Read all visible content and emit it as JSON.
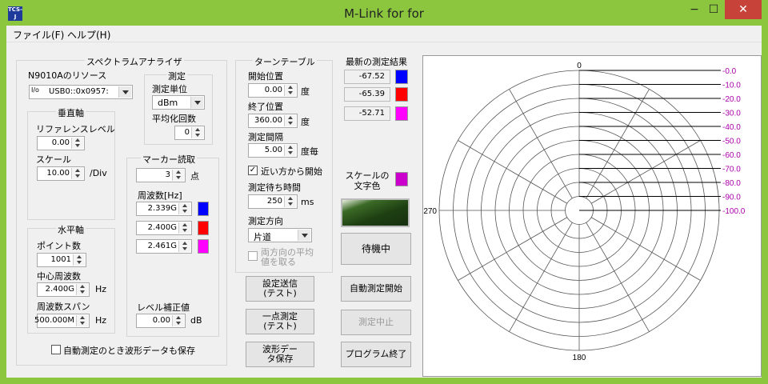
{
  "window": {
    "title": "M-Link for for",
    "app_icon": "TCS-J",
    "min": "−",
    "max": "☐",
    "close": "✕"
  },
  "menu": {
    "file": "ファイル(F)",
    "help": "ヘルプ(H)"
  },
  "spectrum": {
    "title": "スペクトラムアナライザ",
    "resource_label": "N9010Aのリソース",
    "resource_value": "USB0::0x0957:",
    "resource_icon_text": "I/o",
    "vertical": {
      "title": "垂直軸",
      "ref_label": "リファレンスレベル",
      "ref_value": "0.00",
      "scale_label": "スケール",
      "scale_value": "10.00",
      "scale_unit": "/Div"
    },
    "horizontal": {
      "title": "水平軸",
      "points_label": "ポイント数",
      "points_value": "1001",
      "center_label": "中心周波数",
      "center_value": "2.400G",
      "center_unit": "Hz",
      "span_label": "周波数スパン",
      "span_value": "500.000M",
      "span_unit": "Hz"
    },
    "measure": {
      "title": "測定",
      "unit_label": "測定単位",
      "unit_value": "dBm",
      "avg_label": "平均化回数",
      "avg_value": "0"
    },
    "marker": {
      "title": "マーカー読取",
      "count_value": "3",
      "count_unit": "点",
      "freq_label": "周波数[Hz]",
      "freqs": [
        "2.339G",
        "2.400G",
        "2.461G"
      ],
      "colors": [
        "#0000ff",
        "#ff0000",
        "#ff00ff"
      ]
    },
    "level": {
      "label": "レベル補正値",
      "value": "0.00",
      "unit": "dB"
    },
    "save_wave_label": "自動測定のとき波形データも保存"
  },
  "turntable": {
    "title": "ターンテーブル",
    "start_label": "開始位置",
    "start_value": "0.00",
    "start_unit": "度",
    "end_label": "終了位置",
    "end_value": "360.00",
    "end_unit": "度",
    "interval_label": "測定間隔",
    "interval_value": "5.00",
    "interval_unit": "度毎",
    "near_label": "近い方から開始",
    "wait_label": "測定待ち時間",
    "wait_value": "250",
    "wait_unit": "ms",
    "dir_label": "測定方向",
    "dir_value": "片道",
    "avg_both_label": "両方向の平均値を取る"
  },
  "buttons": {
    "send_settings": "設定送信(テスト)",
    "single_measure": "一点測定(テスト)",
    "save_wave": "波形データ保存",
    "auto_start": "自動測定開始",
    "stop": "測定中止",
    "exit": "プログラム終了",
    "status": "待機中"
  },
  "latest": {
    "title": "最新の測定結果",
    "values": [
      "-67.52",
      "-65.39",
      "-52.71"
    ],
    "colors": [
      "#0000ff",
      "#ff0000",
      "#ff00ff"
    ]
  },
  "scale_color": {
    "label": "スケールの文字色",
    "color": "#cc00cc"
  },
  "chart_data": {
    "type": "polar",
    "angle_labels": [
      "0",
      "270",
      "180"
    ],
    "radial_labels": [
      "0.0",
      "10.0",
      "20.0",
      "30.0",
      "40.0",
      "50.0",
      "60.0",
      "70.0",
      "80.0",
      "90.0",
      "100.0"
    ],
    "radial_label_color": "#aa00aa",
    "angle_step_deg": 30
  }
}
